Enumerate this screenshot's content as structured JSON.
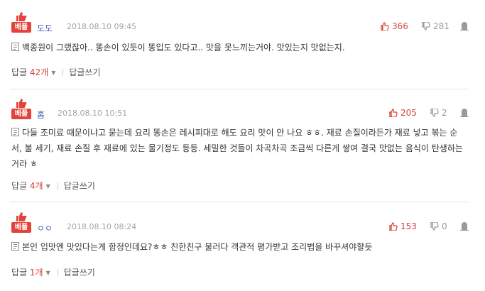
{
  "comments": [
    {
      "badge": "베플",
      "nickname": "도도",
      "date": "2018.08.10 09:45",
      "upvotes": "366",
      "downvotes": "281",
      "text": "백종원이 그랬잖아.. 똥손이 있듯이 똥입도 있다고.. 맛을 못느끼는거야. 맛있는지 맛없는지.",
      "reply_label": "답글",
      "reply_count": "42개",
      "write_reply": "답글쓰기"
    },
    {
      "badge": "베플",
      "nickname": "홈",
      "date": "2018.08.10 10:51",
      "upvotes": "205",
      "downvotes": "2",
      "text": "다들 조미료 때문이냐고 묻는데 요리 똥손은 레시피대로 해도 요리 맛이 안 나요 ㅎㅎ. 재료 손질이라든가 재료 넣고 볶는 순서, 불 세기, 재료 손질 후 재료에 있는 물기정도 등등. 세밀한 것들이 차곡차곡 조금씩 다른게 쌓여 결국 맛없는 음식이 탄생하는거라 ㅎ",
      "reply_label": "답글",
      "reply_count": "4개",
      "write_reply": "답글쓰기"
    },
    {
      "badge": "베플",
      "nickname": "ㅇㅇ",
      "date": "2018.08.10 08:24",
      "upvotes": "153",
      "downvotes": "0",
      "text": "본인 입맛엔 맛있다는게 함정인데요?ㅎㅎ 친한친구 불러다 객관적 평가받고 조리법을 바꾸셔야할듯",
      "reply_label": "답글",
      "reply_count": "1개",
      "write_reply": "답글쓰기"
    }
  ],
  "icons": {
    "thumb": "thumbs-up-icon",
    "up": "thumbs-up-icon",
    "down": "thumbs-down-icon",
    "report": "report-icon",
    "doc": "document-icon",
    "caret": "caret-down-icon"
  },
  "colors": {
    "best_badge": "#e2433a",
    "nickname": "#4661b5",
    "upvote": "#d3433c"
  }
}
